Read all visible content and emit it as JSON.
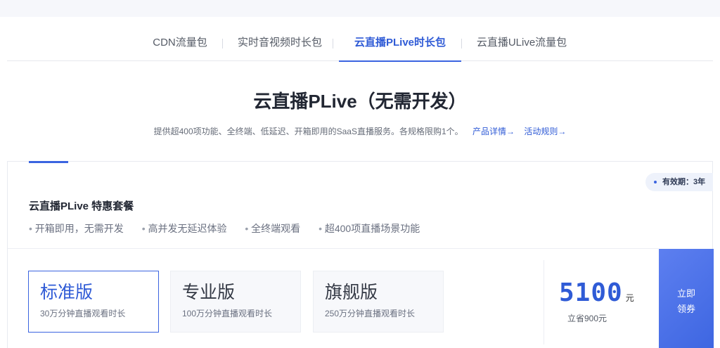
{
  "tabs": [
    {
      "label": "CDN流量包",
      "active": false
    },
    {
      "label": "实时音视频时长包",
      "active": false
    },
    {
      "label": "云直播PLive时长包",
      "active": true
    },
    {
      "label": "云直播ULive流量包",
      "active": false
    }
  ],
  "header": {
    "title": "云直播PLive（无需开发）",
    "subtitle": "提供超400项功能、全终端、低延迟、开箱即用的SaaS直播服务。各规格限购1个。",
    "product_link": "产品详情→",
    "rules_link": "活动规则→"
  },
  "card": {
    "validity": "有效期：3年",
    "title": "云直播PLive 特惠套餐",
    "features": [
      "开箱即用，无需开发",
      "高并发无延迟体验",
      "全终端观看",
      "超400项直播场景功能"
    ],
    "options": [
      {
        "name": "标准版",
        "desc": "30万分钟直播观看时长",
        "selected": true
      },
      {
        "name": "专业版",
        "desc": "100万分钟直播观看时长",
        "selected": false
      },
      {
        "name": "旗舰版",
        "desc": "250万分钟直播观看时长",
        "selected": false
      }
    ],
    "price": "5100",
    "price_unit": "元",
    "save": "立省900元",
    "claim_line1": "立即",
    "claim_line2": "领券"
  },
  "colors": {
    "accent": "#3b64e0",
    "text_dark": "#222733",
    "muted": "#6a7080"
  }
}
